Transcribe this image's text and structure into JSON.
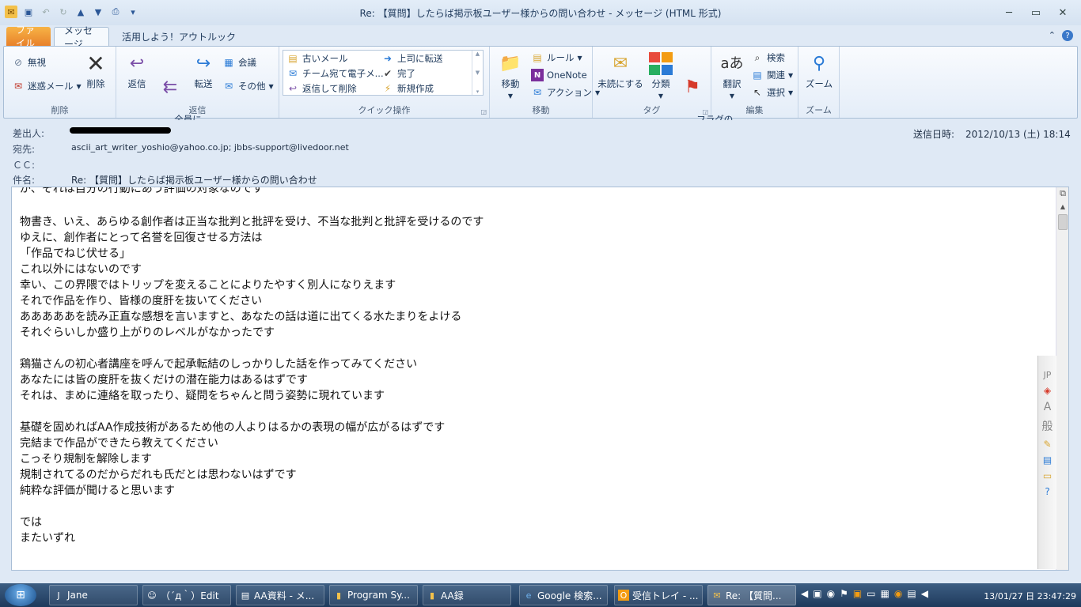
{
  "window": {
    "title": "Re: 【質問】したらば掲示板ユーザー様からの問い合わせ - メッセージ (HTML 形式)",
    "controls": {
      "minimize": "─",
      "restore": "▭",
      "close": "✕"
    }
  },
  "tabs": {
    "file": "ファイル",
    "message": "メッセージ",
    "outlook": "活用しよう！アウトルック"
  },
  "ribbon": {
    "delete_group": {
      "label": "削除",
      "ignore": "無視",
      "junk": "迷惑メール",
      "delete": "削除"
    },
    "respond_group": {
      "label": "返信",
      "reply": "返信",
      "reply_all": "全員に\n返信",
      "forward": "転送",
      "meeting": "会議",
      "more": "その他"
    },
    "quick_group": {
      "label": "クイック操作",
      "items": [
        "古いメール",
        "チーム宛て電子メ...",
        "返信して削除",
        "上司に転送",
        "完了",
        "新規作成"
      ]
    },
    "move_group": {
      "label": "移動",
      "move": "移動",
      "rules": "ルール",
      "onenote": "OneNote",
      "actions": "アクション"
    },
    "tags_group": {
      "label": "タグ",
      "unread": "未読にする",
      "categorize": "分類",
      "flag": "フラグの\n設定"
    },
    "edit_group": {
      "label": "編集",
      "translate": "翻訳",
      "find": "検索",
      "related": "関連",
      "select": "選択"
    },
    "zoom_group": {
      "label": "ズーム",
      "zoom": "ズーム"
    }
  },
  "header": {
    "from_label": "差出人:",
    "to_label": "宛先:",
    "to_value": "ascii_art_writer_yoshio@yahoo.co.jp; jbbs-support@livedoor.net",
    "cc_label": "ＣＣ:",
    "subject_label": "件名:",
    "subject_value": "Re: 【質問】したらば掲示板ユーザー様からの問い合わせ",
    "sent_label": "送信日時:",
    "sent_value": "2012/10/13 (土) 18:14"
  },
  "body": {
    "cut_line": "が、それは自分の行動にあう評価の対象なのです",
    "text": "\n物書き、いえ、あらゆる創作者は正当な批判と批評を受け、不当な批判と批評を受けるのです\nゆえに、創作者にとって名誉を回復させる方法は\n「作品でねじ伏せる」\nこれ以外にはないのです\n幸い、この界隈ではトリップを変えることによりたやすく別人になりえます\nそれで作品を作り、皆様の度肝を抜いてください\nあああああを読み正直な感想を言いますと、あなたの話は道に出てくる水たまりをよける\nそれぐらいしか盛り上がりのレベルがなかったです\n\n鶏猫さんの初心者講座を呼んで起承転結のしっかりした話を作ってみてください\nあなたには皆の度肝を抜くだけの潜在能力はあるはずです\nそれは、まめに連絡を取ったり、疑問をちゃんと問う姿勢に現れています\n\n基礎を固めればAA作成技術があるため他の人よりはるかの表現の幅が広がるはずです\n完結まで作品ができたら教えてください\nこっそり規制を解除します\n規制されてるのだからだれも氏だとは思わないはずです\n純粋な評価が聞けると思います\n\nでは\nまたいずれ"
  },
  "ime_bar": [
    "JP",
    "A",
    "般"
  ],
  "taskbar": {
    "items": [
      "Jane",
      "（´д｀）Edit",
      "AA資料 - メ...",
      "Program Sy...",
      "AA録",
      "Google 検索...",
      "受信トレイ - ...",
      "Re: 【質問..."
    ],
    "clock": "13/01/27 日  23:47:29"
  }
}
